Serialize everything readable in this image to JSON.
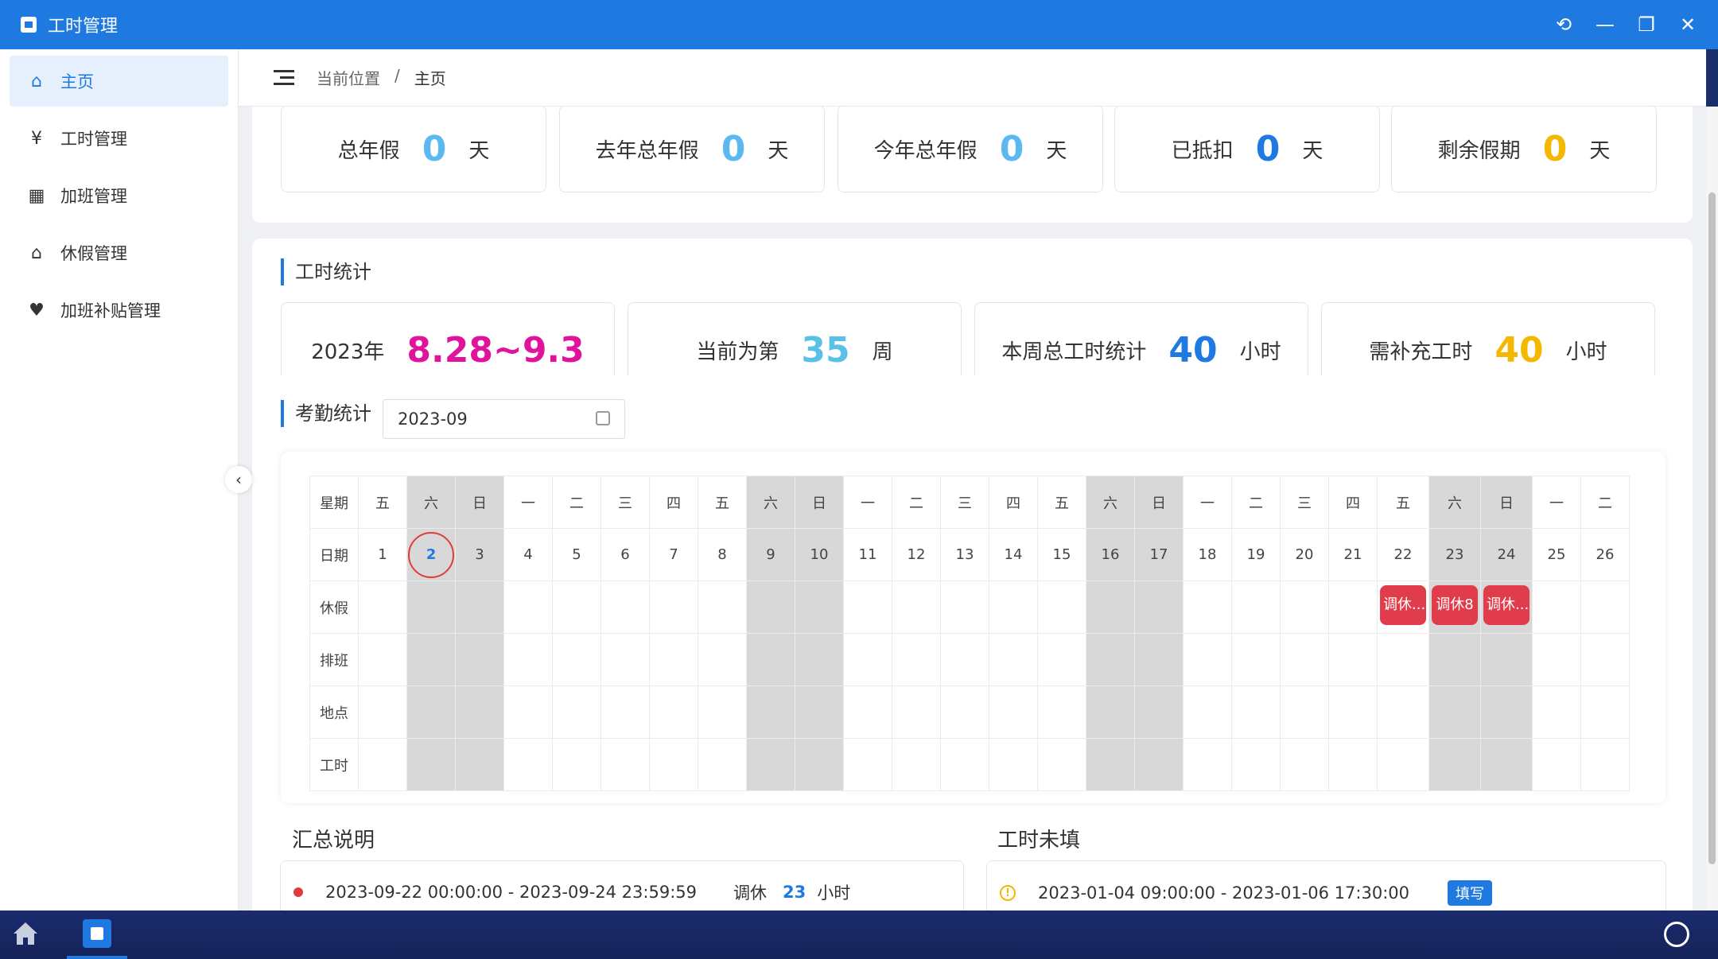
{
  "window": {
    "title": "工时管理",
    "controls": [
      "refresh",
      "minimize",
      "restore",
      "close"
    ]
  },
  "sidebar": {
    "items": [
      {
        "label": "主页",
        "icon": "home-icon",
        "active": true
      },
      {
        "label": "工时管理",
        "icon": "yen-icon"
      },
      {
        "label": "加班管理",
        "icon": "calendar-check-icon"
      },
      {
        "label": "休假管理",
        "icon": "bank-icon"
      },
      {
        "label": "加班补贴管理",
        "icon": "subsidy-icon"
      }
    ]
  },
  "breadcrumb": {
    "prefix": "当前位置",
    "sep": "/",
    "current": "主页"
  },
  "leave_stats": [
    {
      "label": "总年假",
      "value": "0",
      "unit": "天",
      "color": "#5bb8f0"
    },
    {
      "label": "去年总年假",
      "value": "0",
      "unit": "天",
      "color": "#5bb8f0"
    },
    {
      "label": "今年总年假",
      "value": "0",
      "unit": "天",
      "color": "#5bb8f0"
    },
    {
      "label": "已抵扣",
      "value": "0",
      "unit": "天",
      "color": "#1e7ae0"
    },
    {
      "label": "剩余假期",
      "value": "0",
      "unit": "天",
      "color": "#f5b800"
    }
  ],
  "work_stats": {
    "title": "工时统计",
    "year": "2023年",
    "range": "8.28~9.3",
    "range_color": "#e0139c",
    "week_prefix": "当前为第",
    "week_value": "35",
    "week_suffix": "周",
    "week_color": "#5bc0e8",
    "total_label": "本周总工时统计",
    "total_value": "40",
    "total_unit": "小时",
    "total_color": "#1e7ae0",
    "need_label": "需补充工时",
    "need_value": "40",
    "need_unit": "小时",
    "need_color": "#f5b800"
  },
  "attendance": {
    "title": "考勤统计",
    "month": "2023-09",
    "row_labels": [
      "星期",
      "日期",
      "休假",
      "排班",
      "地点",
      "工时"
    ],
    "weekdays": [
      "五",
      "六",
      "日",
      "一",
      "二",
      "三",
      "四",
      "五",
      "六",
      "日",
      "一",
      "二",
      "三",
      "四",
      "五",
      "六",
      "日",
      "一",
      "二",
      "三",
      "四",
      "五",
      "六",
      "日",
      "一",
      "二"
    ],
    "dates": [
      "1",
      "2",
      "3",
      "4",
      "5",
      "6",
      "7",
      "8",
      "9",
      "10",
      "11",
      "12",
      "13",
      "14",
      "15",
      "16",
      "17",
      "18",
      "19",
      "20",
      "21",
      "22",
      "23",
      "24",
      "25",
      "26"
    ],
    "weekend_index": [
      1,
      2,
      8,
      9,
      15,
      16,
      22,
      23
    ],
    "today_index": 1,
    "leave_tags": [
      {
        "index": 21,
        "text": "调休..."
      },
      {
        "index": 22,
        "text": "调休8"
      },
      {
        "index": 23,
        "text": "调休..."
      }
    ]
  },
  "summary": {
    "title": "汇总说明",
    "row": {
      "range": "2023-09-22 00:00:00 - 2023-09-24 23:59:59",
      "type": "调休",
      "value": "23",
      "unit": "小时"
    }
  },
  "missing": {
    "title": "工时未填",
    "row": {
      "range": "2023-01-04 09:00:00 - 2023-01-06 17:30:00",
      "action": "填写"
    }
  }
}
